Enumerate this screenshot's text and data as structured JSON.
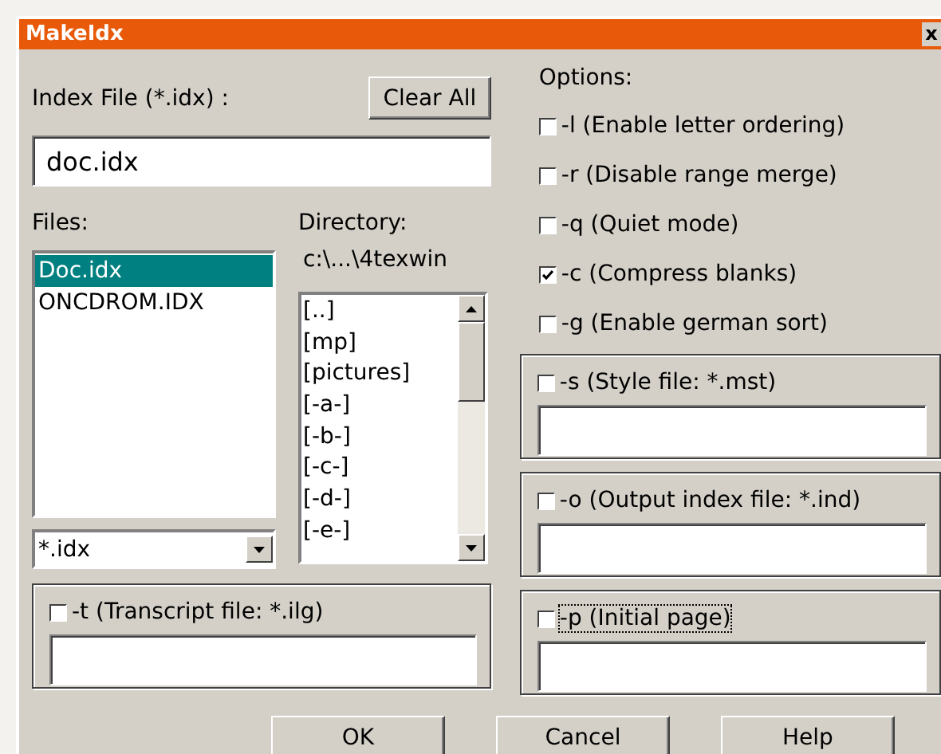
{
  "window": {
    "title": "MakeIdx",
    "close": "x"
  },
  "index_file": {
    "label": "Index File (*.idx) :",
    "value": "doc.idx",
    "clear_button": "Clear All"
  },
  "files": {
    "label": "Files:",
    "filter": "*.idx",
    "items": [
      {
        "text": "Doc.idx",
        "selected": true
      },
      {
        "text": "ONCDROM.IDX",
        "selected": false
      }
    ]
  },
  "directory": {
    "label": "Directory:",
    "path": "c:\\...\\4texwin",
    "items": [
      "[..]",
      "[mp]",
      "[pictures]",
      "[-a-]",
      "[-b-]",
      "[-c-]",
      "[-d-]",
      "[-e-]"
    ]
  },
  "transcript": {
    "label": "-t (Transcript file: *.ilg)",
    "checked": false,
    "focused": false
  },
  "options": {
    "label": "Options:",
    "items": [
      {
        "label": "-l (Enable letter ordering)",
        "checked": false
      },
      {
        "label": "-r (Disable range merge)",
        "checked": false
      },
      {
        "label": "-q (Quiet mode)",
        "checked": false
      },
      {
        "label": "-c (Compress blanks)",
        "checked": true
      },
      {
        "label": "-g (Enable german sort)",
        "checked": false
      }
    ]
  },
  "groups": [
    {
      "label": "-s (Style file: *.mst)",
      "checked": false,
      "focused": false
    },
    {
      "label": "-o (Output index file: *.ind)",
      "checked": false,
      "focused": false
    },
    {
      "label": "-p (Initial page)",
      "checked": false,
      "focused": true
    }
  ],
  "buttons": [
    "OK",
    "Cancel",
    "Help"
  ]
}
